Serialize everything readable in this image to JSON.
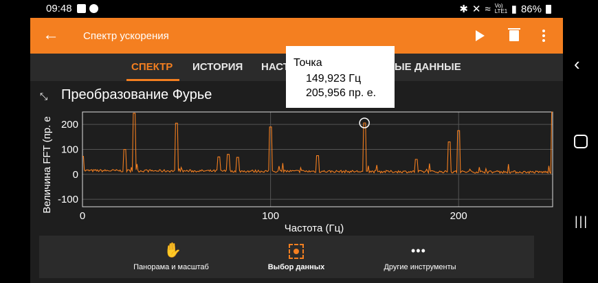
{
  "status_bar": {
    "time": "09:48",
    "battery": "86%",
    "network_label": "Vo) LTE1"
  },
  "toolbar": {
    "title": "Спектр ускорения",
    "back_icon": "arrow-left-icon",
    "play_icon": "play-icon",
    "delete_icon": "trash-icon",
    "more_icon": "more-vert-icon"
  },
  "tabs": [
    {
      "label": "СПЕКТР",
      "active": true
    },
    {
      "label": "ИСТОРИЯ",
      "active": false
    },
    {
      "label": "НАСТ",
      "active": false
    },
    {
      "label": "ЫЕ ДАННЫЕ",
      "active": false
    }
  ],
  "panel": {
    "title": "Преобразование Фурье",
    "collapse_icon": "collapse-icon"
  },
  "tooltip": {
    "title": "Точка",
    "freq": "149,923 Гц",
    "value": "205,956 пр. е."
  },
  "chart_data": {
    "type": "line",
    "xlabel": "Частота (Гц)",
    "ylabel": "Величина FFT (пр. е",
    "xlim": [
      0,
      250
    ],
    "ylim": [
      -130,
      250
    ],
    "xticks": [
      "0",
      "100",
      "200"
    ],
    "yticks": [
      "200",
      "100",
      "0",
      "-100"
    ],
    "grid": true,
    "color": "#f47f20",
    "marker": {
      "x": 149.923,
      "y": 205.956
    },
    "peaks": [
      {
        "x": 0,
        "y": 72
      },
      {
        "x": 22.5,
        "y": 100
      },
      {
        "x": 27.5,
        "y": 245
      },
      {
        "x": 50,
        "y": 205
      },
      {
        "x": 72.5,
        "y": 70
      },
      {
        "x": 77.5,
        "y": 80
      },
      {
        "x": 82.5,
        "y": 68
      },
      {
        "x": 100,
        "y": 190
      },
      {
        "x": 125,
        "y": 75
      },
      {
        "x": 149.923,
        "y": 205.956
      },
      {
        "x": 177.5,
        "y": 60
      },
      {
        "x": 195,
        "y": 130
      },
      {
        "x": 200,
        "y": 175
      },
      {
        "x": 250,
        "y": 250
      }
    ]
  },
  "bottom_bar": {
    "items": [
      {
        "label": "Панорама и масштаб",
        "icon": "hand-icon",
        "selected": false
      },
      {
        "label": "Выбор данных",
        "icon": "select-data-icon",
        "selected": true
      },
      {
        "label": "Другие инструменты",
        "icon": "more-horiz-icon",
        "selected": false
      }
    ]
  }
}
